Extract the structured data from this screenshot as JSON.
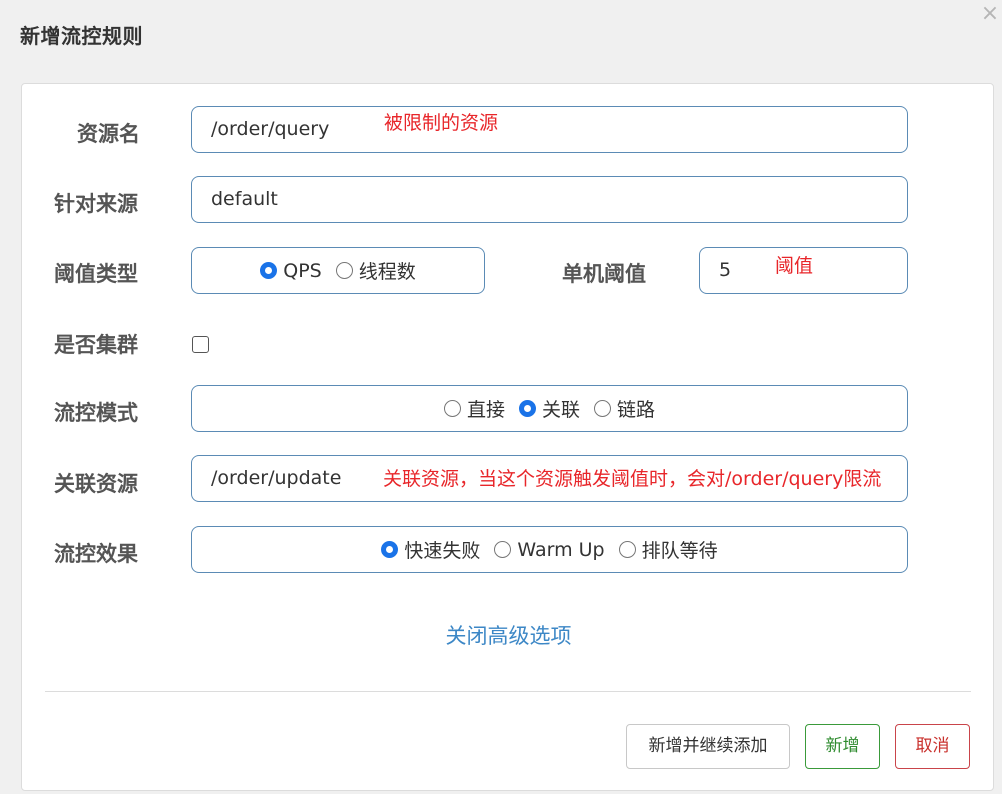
{
  "dialog": {
    "title": "新增流控规则",
    "close_glyph": "×"
  },
  "form": {
    "resource": {
      "label": "资源名",
      "value": "/order/query",
      "annotation": "被限制的资源"
    },
    "limit_app": {
      "label": "针对来源",
      "value": "default"
    },
    "threshold_type": {
      "label": "阈值类型",
      "options": [
        "QPS",
        "线程数"
      ],
      "selected": "QPS"
    },
    "threshold": {
      "label": "单机阈值",
      "value": "5",
      "annotation": "阈值"
    },
    "cluster": {
      "label": "是否集群",
      "checked": false
    },
    "strategy": {
      "label": "流控模式",
      "options": [
        "直接",
        "关联",
        "链路"
      ],
      "selected": "关联"
    },
    "ref_resource": {
      "label": "关联资源",
      "value": "/order/update",
      "annotation_prefix": "关联资源，当这个资源触发阈值时，会对",
      "annotation_target": "/order/query",
      "annotation_suffix": "限流"
    },
    "control_behavior": {
      "label": "流控效果",
      "options": [
        "快速失败",
        "Warm Up",
        "排队等待"
      ],
      "selected": "快速失败"
    },
    "advanced_toggle": "关闭高级选项"
  },
  "buttons": {
    "add_continue": "新增并继续添加",
    "add": "新增",
    "cancel": "取消"
  },
  "colors": {
    "annotation": "#e8262a",
    "link": "#3c87c6",
    "radio_checked": "#1a73e8",
    "field_border": "#5b8bb5"
  }
}
